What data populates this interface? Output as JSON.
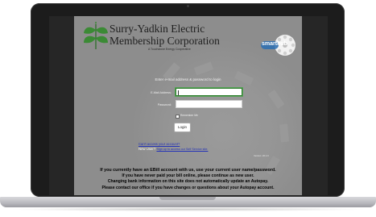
{
  "header": {
    "coop_name_line1": "Surry-Yadkin Electric",
    "coop_name_line2": "Membership Corporation",
    "coop_tagline": "A Touchstone Energy Cooperative",
    "smarthub_logo_text": "smarthub"
  },
  "login": {
    "prompt": "Enter e-mail address & password to login",
    "email_label": "E-Mail Address:",
    "email_value": "",
    "password_label": "Password:",
    "password_value": "",
    "remember_me_label": "Remember Me",
    "remember_me_checked": false,
    "login_button": "Login",
    "cant_access_link": "Can't access your account?",
    "new_user_prefix": "New User?",
    "new_user_link": "Sign up to access our Self Service site.",
    "version": "Version: 20.1.0"
  },
  "notes": {
    "line1": "If you currently have an EBill account with us, use your current user name/password.",
    "line2": "If you have never paid your bill online, please continue as new user.",
    "line3": "Changing bank information on this site  does not automatically update an Autopay.",
    "line4": "Please contact our office if you have changes or questions about your Autopay account."
  },
  "colors": {
    "panel_bg": "#8d8d8d",
    "leaf_green": "#3b8a35",
    "smarthub_blue": "#2a6fb3",
    "link_blue": "#2332b8",
    "focus_green": "#2f7d2f"
  }
}
